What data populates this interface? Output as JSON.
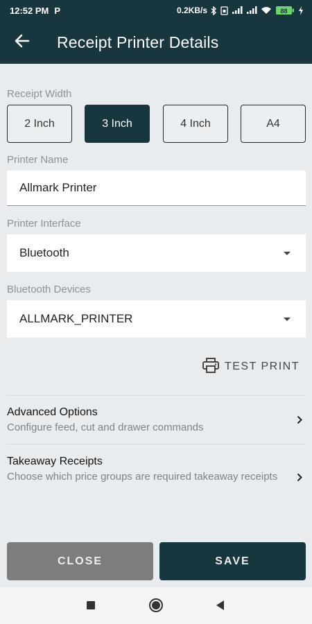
{
  "status_bar": {
    "time": "12:52 PM",
    "carrier_glyph": "P",
    "net_speed": "0.2KB/s",
    "battery": "88"
  },
  "app_bar": {
    "title": "Receipt Printer Details",
    "back_icon": "arrow-left-icon"
  },
  "receipt_width": {
    "label": "Receipt Width",
    "options": [
      "2 Inch",
      "3 Inch",
      "4 Inch",
      "A4"
    ],
    "selected": "3 Inch"
  },
  "printer_name": {
    "label": "Printer Name",
    "value": "Allmark Printer"
  },
  "printer_interface": {
    "label": "Printer Interface",
    "value": "Bluetooth"
  },
  "bluetooth_devices": {
    "label": "Bluetooth Devices",
    "value": "ALLMARK_PRINTER"
  },
  "test_print": {
    "label": "TEST PRINT",
    "icon": "printer-icon"
  },
  "options": [
    {
      "title": "Advanced Options",
      "description": "Configure feed, cut and drawer commands"
    },
    {
      "title": "Takeaway Receipts",
      "description": "Choose which price groups are required takeaway receipts"
    }
  ],
  "buttons": {
    "close": "CLOSE",
    "save": "SAVE"
  },
  "colors": {
    "primary": "#17363d",
    "background": "#e9ecef",
    "close_button": "#7d7d7d"
  }
}
